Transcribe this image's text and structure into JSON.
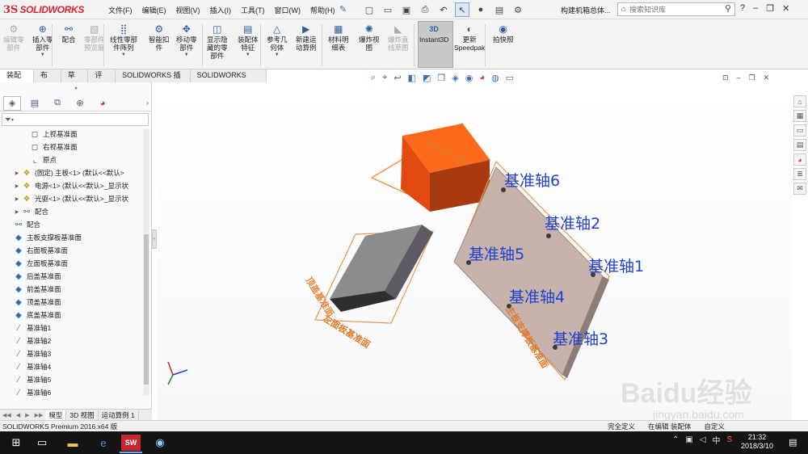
{
  "app": {
    "logo_ds": "3S",
    "logo_name": "SOLIDWORKS",
    "document_title": "构建机箱总体...",
    "search_placeholder": "搜索知识库"
  },
  "menu": [
    "文件(F)",
    "编辑(E)",
    "视图(V)",
    "插入(I)",
    "工具(T)",
    "窗口(W)",
    "帮助(H)"
  ],
  "quick_access_icons": [
    "new-icon",
    "open-icon",
    "save-icon",
    "print-icon",
    "undo-icon",
    "select-icon",
    "rebuild-icon",
    "file-properties-icon",
    "options-icon"
  ],
  "window_controls": [
    "help-icon",
    "minimize-icon",
    "restore-icon",
    "close-icon"
  ],
  "command_manager": [
    {
      "id": "edit-component",
      "label": "编辑零\n部件",
      "disabled": true
    },
    {
      "id": "insert-component",
      "label": "插入零\n部件",
      "disabled": false,
      "dropdown": true
    },
    {
      "id": "mate",
      "label": "配合",
      "disabled": false
    },
    {
      "id": "component-preview",
      "label": "零部件\n预览窗",
      "disabled": true
    },
    {
      "id": "linear-pattern",
      "label": "线性零部\n件阵列",
      "disabled": false,
      "dropdown": true
    },
    {
      "id": "smart-fasteners",
      "label": "智能扣\n件",
      "disabled": false
    },
    {
      "id": "move-component",
      "label": "移动零\n部件",
      "disabled": false,
      "dropdown": true
    },
    {
      "id": "show-hidden",
      "label": "显示隐\n藏的零\n部件",
      "disabled": false
    },
    {
      "id": "assembly-features",
      "label": "装配体\n特征",
      "disabled": false,
      "dropdown": true
    },
    {
      "id": "reference-geometry",
      "label": "参考几\n何体",
      "disabled": false,
      "dropdown": true
    },
    {
      "id": "new-motion-study",
      "label": "新建运\n动算例",
      "disabled": false
    },
    {
      "id": "bom",
      "label": "材料明\n细表",
      "disabled": false
    },
    {
      "id": "exploded-view",
      "label": "爆炸视\n图",
      "disabled": false
    },
    {
      "id": "explode-line-sketch",
      "label": "爆炸直\n线草图",
      "disabled": true
    },
    {
      "id": "instant3d",
      "label": "Instant3D",
      "disabled": false,
      "active": true
    },
    {
      "id": "update-speedpak",
      "label": "更新\nSpeedpak",
      "disabled": false
    },
    {
      "id": "snapshot",
      "label": "拍快照",
      "disabled": false
    }
  ],
  "command_tabs": [
    "装配体",
    "布局",
    "草图",
    "评估",
    "SOLIDWORKS 插件",
    "SOLIDWORKS MBD"
  ],
  "active_command_tab": "装配体",
  "feature_tree": [
    {
      "label": "上视基准面",
      "icon": "plane-icon",
      "expandable": false,
      "indent": 2
    },
    {
      "label": "右视基准面",
      "icon": "plane-icon",
      "expandable": false,
      "indent": 2
    },
    {
      "label": "原点",
      "icon": "origin-icon",
      "expandable": false,
      "indent": 2
    },
    {
      "label": "(固定) 主板<1> (默认<<默认>",
      "icon": "part-icon",
      "expandable": true,
      "indent": 1
    },
    {
      "label": "电源<1> (默认<<默认>_显示状",
      "icon": "part-icon",
      "expandable": true,
      "indent": 1
    },
    {
      "label": "光驱<1> (默认<<默认>_显示状",
      "icon": "part-icon",
      "expandable": true,
      "indent": 1
    },
    {
      "label": "配合",
      "icon": "mate-icon",
      "expandable": true,
      "indent": 1
    },
    {
      "label": "配合",
      "icon": "mate-icon",
      "expandable": false,
      "indent": 0
    },
    {
      "label": "主板支撑板基准面",
      "icon": "ref-plane-icon",
      "expandable": false,
      "indent": 0
    },
    {
      "label": "右面板基准面",
      "icon": "ref-plane-icon",
      "expandable": false,
      "indent": 0
    },
    {
      "label": "左面板基准面",
      "icon": "ref-plane-icon",
      "expandable": false,
      "indent": 0
    },
    {
      "label": "后盖基准面",
      "icon": "ref-plane-icon",
      "expandable": false,
      "indent": 0
    },
    {
      "label": "前盖基准面",
      "icon": "ref-plane-icon",
      "expandable": false,
      "indent": 0
    },
    {
      "label": "顶盖基准面",
      "icon": "ref-plane-icon",
      "expandable": false,
      "indent": 0
    },
    {
      "label": "底盖基准面",
      "icon": "ref-plane-icon",
      "expandable": false,
      "indent": 0
    },
    {
      "label": "基准轴1",
      "icon": "axis-icon",
      "expandable": false,
      "indent": 0
    },
    {
      "label": "基准轴2",
      "icon": "axis-icon",
      "expandable": false,
      "indent": 0
    },
    {
      "label": "基准轴3",
      "icon": "axis-icon",
      "expandable": false,
      "indent": 0
    },
    {
      "label": "基准轴4",
      "icon": "axis-icon",
      "expandable": false,
      "indent": 0
    },
    {
      "label": "基准轴5",
      "icon": "axis-icon",
      "expandable": false,
      "indent": 0
    },
    {
      "label": "基准轴6",
      "icon": "axis-icon",
      "expandable": false,
      "indent": 0
    }
  ],
  "panel_tabs": [
    "feature-manager-icon",
    "property-manager-icon",
    "configuration-manager-icon",
    "dimxpert-icon",
    "display-manager-icon"
  ],
  "bottom_tabs": [
    "模型",
    "3D 视图",
    "运动算例 1"
  ],
  "viewport": {
    "axis_labels": [
      "基准轴6",
      "基准轴2",
      "基准轴5",
      "基准轴1",
      "基准轴4",
      "基准轴3"
    ],
    "plane_labels": [
      "左面板基准面",
      "主板支撑板基准面"
    ],
    "colors": {
      "orange_box": "#e24a12",
      "gray_box": "#8c8c8c",
      "plate": "#c7b2ac",
      "plane_outline": "#f0944a",
      "axis_text": "#1f3fcf"
    }
  },
  "heads_up_icons": [
    "zoom-fit-icon",
    "zoom-area-icon",
    "previous-view-icon",
    "section-view-icon",
    "dynamic-annotation-icon",
    "view-orientation-icon",
    "display-style-icon",
    "hide-show-icon",
    "edit-appearance-icon",
    "apply-scene-icon",
    "view-settings-icon"
  ],
  "task_pane_icons": [
    "home-icon",
    "design-library-icon",
    "file-explorer-icon",
    "view-palette-icon",
    "appearances-icon",
    "custom-properties-icon",
    "forum-icon"
  ],
  "status": {
    "product": "SOLIDWORKS Premium 2016 x64 版",
    "state": "完全定义",
    "editing": "在编辑 装配体",
    "units": "自定义"
  },
  "taskbar": {
    "time": "21:32",
    "date": "2018/3/10",
    "ime": "中"
  },
  "watermark": {
    "text": "Baidu经验",
    "sub": "jingyan.baidu.com"
  }
}
